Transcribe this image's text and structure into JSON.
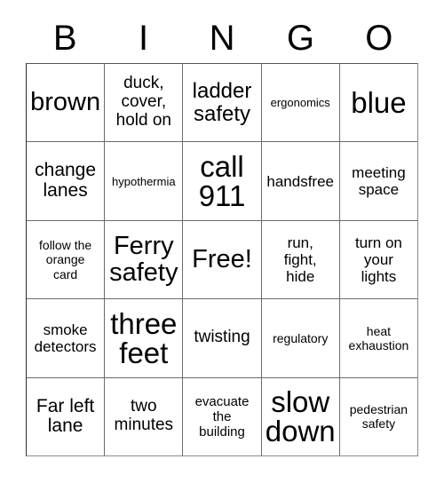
{
  "card": {
    "title": "BINGO",
    "header_letters": [
      "B",
      "I",
      "N",
      "G",
      "O"
    ],
    "free_space_label": "Free!",
    "grid_size": "5x5",
    "colors": {
      "background": "#ffffff",
      "text": "#000000",
      "grid_line": "#6b6b6b",
      "border": "#2b2b2b"
    },
    "rows": [
      {
        "cells": [
          {
            "text": "brown",
            "size": "xxl"
          },
          {
            "text": "duck,\ncover,\nhold on",
            "size": "ml"
          },
          {
            "text": "ladder\nsafety",
            "size": "xl"
          },
          {
            "text": "ergonomics",
            "size": "xs"
          },
          {
            "text": "blue",
            "size": "huge"
          }
        ]
      },
      {
        "cells": [
          {
            "text": "change\nlanes",
            "size": "l"
          },
          {
            "text": "hypothermia",
            "size": "xs"
          },
          {
            "text": "call\n911",
            "size": "huge"
          },
          {
            "text": "handsfree",
            "size": "m"
          },
          {
            "text": "meeting\nspace",
            "size": "m"
          }
        ]
      },
      {
        "cells": [
          {
            "text": "follow the\norange\ncard",
            "size": "s"
          },
          {
            "text": "Ferry\nsafety",
            "size": "xxl"
          },
          {
            "text": "Free!",
            "size": "xxl"
          },
          {
            "text": "run,\nfight,\nhide",
            "size": "m"
          },
          {
            "text": "turn on\nyour\nlights",
            "size": "m"
          }
        ]
      },
      {
        "cells": [
          {
            "text": "smoke\ndetectors",
            "size": "m"
          },
          {
            "text": "three\nfeet",
            "size": "huge"
          },
          {
            "text": "twisting",
            "size": "ml"
          },
          {
            "text": "regulatory",
            "size": "s"
          },
          {
            "text": "heat\nexhaustion",
            "size": "s"
          }
        ]
      },
      {
        "cells": [
          {
            "text": "Far left\nlane",
            "size": "l"
          },
          {
            "text": "two\nminutes",
            "size": "ml"
          },
          {
            "text": "evacuate\nthe\nbuilding",
            "size": "sm"
          },
          {
            "text": "slow\ndown",
            "size": "huge"
          },
          {
            "text": "pedestrian\nsafety",
            "size": "s"
          }
        ]
      }
    ]
  }
}
